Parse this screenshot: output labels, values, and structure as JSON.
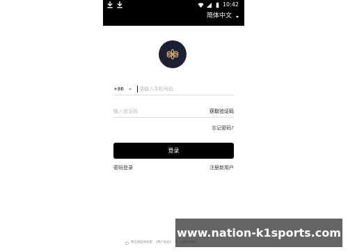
{
  "status_bar": {
    "time": "10:42",
    "left_icons": [
      "download-icon",
      "download-icon"
    ],
    "right_icons": [
      "wifi-icon",
      "signal-icon",
      "battery-icon"
    ]
  },
  "header": {
    "language_label": "简体中文"
  },
  "logo": {
    "icon": "brand-knot-icon"
  },
  "form": {
    "country_code": "+86",
    "phone_placeholder": "请输入手机号码",
    "code_placeholder": "输入验证码",
    "get_code_label": "获取验证码",
    "forgot_password_label": "忘记密码?",
    "login_label": "登录",
    "password_login_label": "密码登录",
    "register_label": "注册新用户"
  },
  "agreement": {
    "prefix": "我已阅读并同意",
    "user_agreement": "《用户协议》",
    "and": "和",
    "privacy_policy": "《隐私政策》"
  },
  "watermark": {
    "text": "www.nation-k1sports.com"
  },
  "colors": {
    "header_bg": "#000000",
    "logo_bg": "#1d2033",
    "logo_gold": "#c9a46a",
    "button_bg": "#000000",
    "watermark_bg": "#3a3a3a"
  }
}
